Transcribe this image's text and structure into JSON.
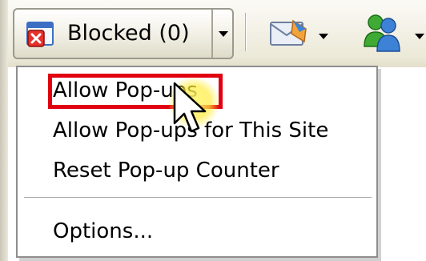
{
  "toolbar": {
    "blocked_button": {
      "label": "Blocked (0)",
      "icon": "popup-blocked-icon"
    },
    "mail_button": {
      "icon": "mail-icon"
    },
    "messenger_button": {
      "icon": "messenger-icon"
    }
  },
  "menu": {
    "items": [
      {
        "label": "Allow Pop-ups",
        "highlighted": true
      },
      {
        "label": "Allow Pop-ups for This Site"
      },
      {
        "label": "Reset Pop-up Counter"
      }
    ],
    "options_label": "Options..."
  },
  "colors": {
    "highlight_border": "#e00010",
    "cursor_glow": "#ffec3c",
    "toolbar_bg": "#ece9d8"
  }
}
